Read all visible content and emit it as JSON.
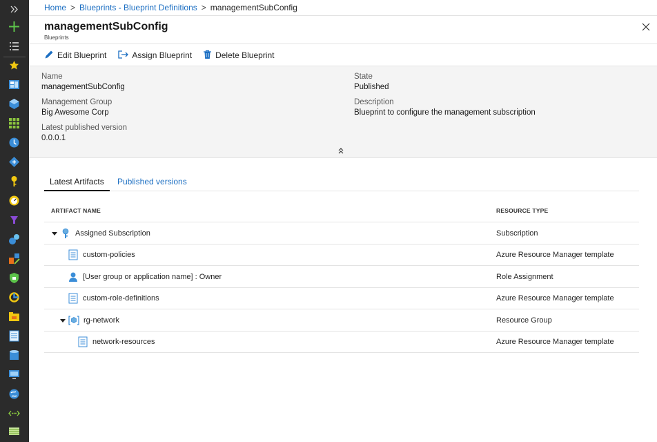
{
  "breadcrumb": {
    "items": [
      "Home",
      "Blueprints - Blueprint Definitions"
    ],
    "current": "managementSubConfig",
    "separator": ">"
  },
  "blade": {
    "title": "managementSubConfig",
    "subtitle": "Blueprints"
  },
  "toolbar": {
    "edit_label": "Edit Blueprint",
    "assign_label": "Assign Blueprint",
    "delete_label": "Delete Blueprint"
  },
  "essentials": {
    "name_label": "Name",
    "name_value": "managementSubConfig",
    "group_label": "Management Group",
    "group_value": "Big Awesome Corp",
    "version_label": "Latest published version",
    "version_value": "0.0.0.1",
    "state_label": "State",
    "state_value": "Published",
    "description_label": "Description",
    "description_value": "Blueprint to configure the management subscription"
  },
  "tabs": {
    "latest": "Latest Artifacts",
    "published": "Published versions"
  },
  "table": {
    "col_name": "ARTIFACT NAME",
    "col_type": "RESOURCE TYPE",
    "rows": [
      {
        "name": "Assigned Subscription",
        "type": "Subscription",
        "icon": "key-icon"
      },
      {
        "name": "custom-policies",
        "type": "Azure Resource Manager template",
        "icon": "document-icon"
      },
      {
        "name": "[User group or application name] : Owner",
        "type": "Role Assignment",
        "icon": "user-icon"
      },
      {
        "name": "custom-role-definitions",
        "type": "Azure Resource Manager template",
        "icon": "document-icon"
      },
      {
        "name": "rg-network",
        "type": "Resource Group",
        "icon": "resource-group-icon"
      },
      {
        "name": "network-resources",
        "type": "Azure Resource Manager template",
        "icon": "document-icon"
      }
    ]
  },
  "colors": {
    "link": "#1b6ec2",
    "nav_bg": "#2b2b2b",
    "essentials_bg": "#f4f4f4",
    "icon_blue": "#3b8ed8"
  }
}
